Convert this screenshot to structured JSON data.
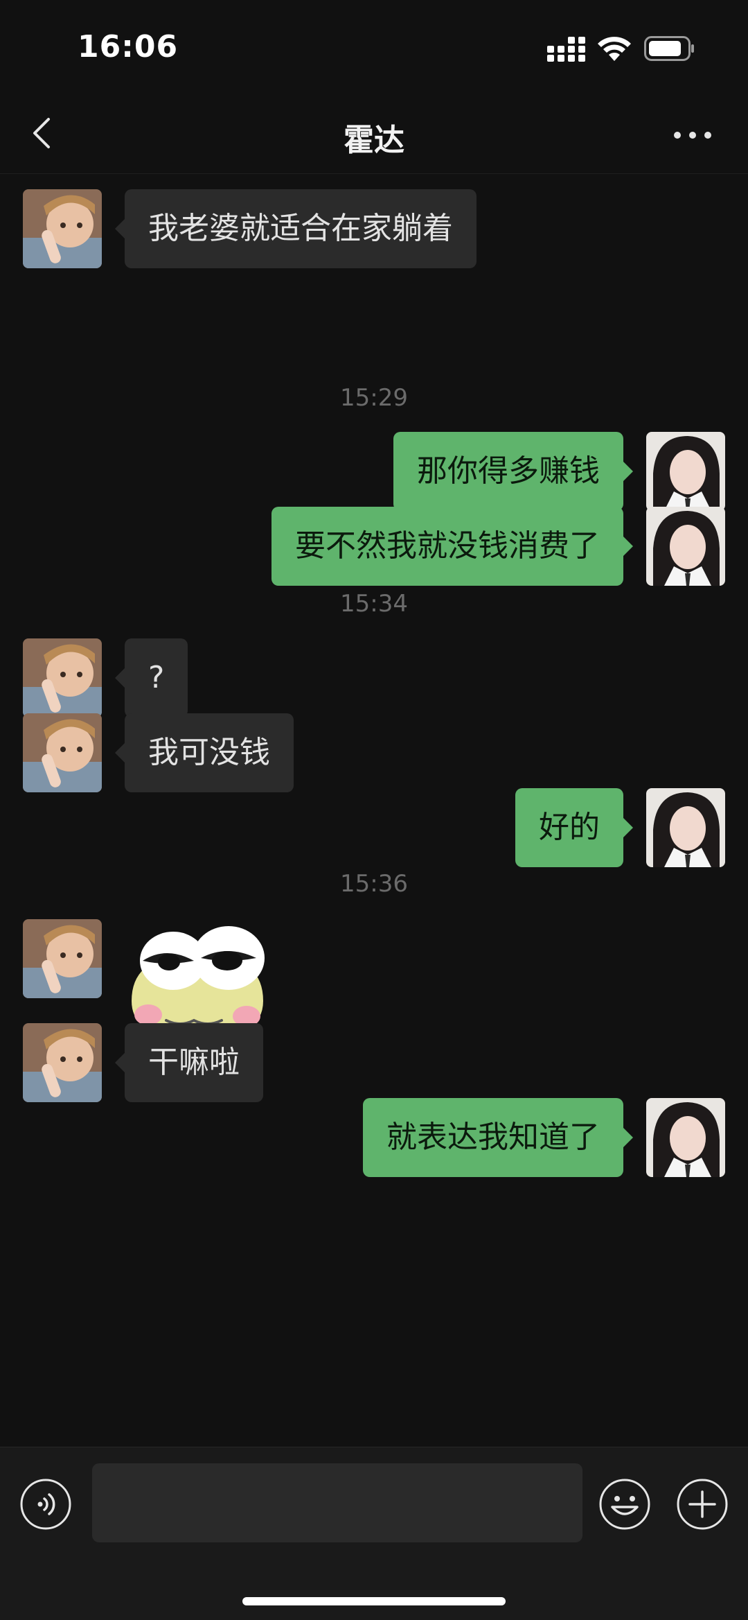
{
  "status_bar": {
    "time": "16:06",
    "battery_icon": "battery-icon",
    "wifi_icon": "wifi-icon",
    "signal_icon": "signal-icon"
  },
  "nav": {
    "title": "霍达",
    "back_icon": "back-icon",
    "more_icon": "more-icon"
  },
  "messages": [
    {
      "from": "them",
      "text": "我老婆就适合在家躺着"
    },
    {
      "type": "time",
      "text": "15:29"
    },
    {
      "from": "me",
      "text": "那你得多赚钱"
    },
    {
      "from": "me",
      "text": "要不然我就没钱消费了"
    },
    {
      "type": "time",
      "text": "15:34"
    },
    {
      "from": "them",
      "text": "?"
    },
    {
      "from": "them",
      "text": "我可没钱"
    },
    {
      "from": "me",
      "text": "好的"
    },
    {
      "type": "time",
      "text": "15:36"
    },
    {
      "from": "them",
      "type": "sticker",
      "sticker": "frog-sticker"
    },
    {
      "from": "them",
      "text": "干嘛啦"
    },
    {
      "from": "me",
      "text": "就表达我知道了"
    }
  ],
  "input_bar": {
    "placeholder": "",
    "voice_icon": "voice-icon",
    "emoji_icon": "emoji-icon",
    "plus_icon": "plus-icon"
  },
  "colors": {
    "background": "#111111",
    "incoming_bubble": "#2b2b2b",
    "outgoing_bubble": "#5fb46c",
    "timestamp": "#6b6b6b"
  }
}
